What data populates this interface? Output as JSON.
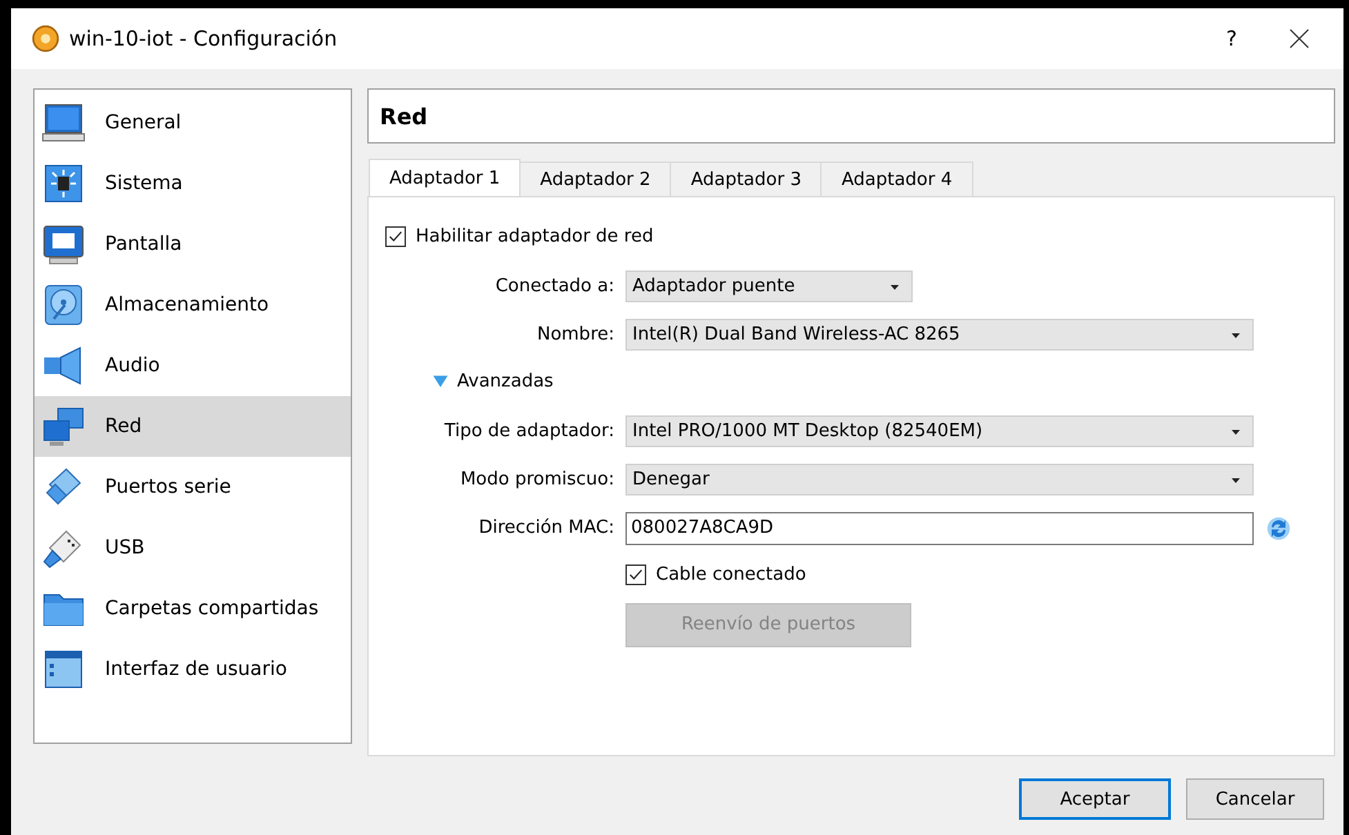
{
  "window": {
    "title": "win-10-iot - Configuración",
    "help": "?"
  },
  "sidebar": {
    "items": [
      {
        "label": "General",
        "selected": false
      },
      {
        "label": "Sistema",
        "selected": false
      },
      {
        "label": "Pantalla",
        "selected": false
      },
      {
        "label": "Almacenamiento",
        "selected": false
      },
      {
        "label": "Audio",
        "selected": false
      },
      {
        "label": "Red",
        "selected": true
      },
      {
        "label": "Puertos serie",
        "selected": false
      },
      {
        "label": "USB",
        "selected": false
      },
      {
        "label": "Carpetas compartidas",
        "selected": false
      },
      {
        "label": "Interfaz de usuario",
        "selected": false
      }
    ]
  },
  "page": {
    "title": "Red",
    "tabs": [
      {
        "label": "Adaptador 1",
        "selected": true
      },
      {
        "label": "Adaptador 2",
        "selected": false
      },
      {
        "label": "Adaptador 3",
        "selected": false
      },
      {
        "label": "Adaptador 4",
        "selected": false
      }
    ],
    "rows": [
      {
        "kind": "checkbox",
        "label": "Habilitar adaptador de red",
        "checked": true
      },
      {
        "kind": "combo",
        "label": "Conectado a:",
        "value": "Adaptador puente",
        "wide": false
      },
      {
        "kind": "combo",
        "label": "Nombre:",
        "value": "Intel(R) Dual Band Wireless-AC 8265",
        "wide": true
      },
      {
        "kind": "disclosure",
        "label": "Avanzadas",
        "expanded": true
      },
      {
        "kind": "combo",
        "label": "Tipo de adaptador:",
        "value": "Intel PRO/1000 MT Desktop (82540EM)",
        "wide": true
      },
      {
        "kind": "combo",
        "label": "Modo promiscuo:",
        "value": "Denegar",
        "wide": true
      },
      {
        "kind": "text",
        "label": "Dirección MAC:",
        "value": "080027A8CA9D"
      },
      {
        "kind": "subcheckbox",
        "label": "Cable conectado",
        "checked": true
      },
      {
        "kind": "button",
        "label": "Reenvío de puertos",
        "disabled": true
      }
    ]
  },
  "buttons": [
    {
      "label": "Aceptar",
      "default": true
    },
    {
      "label": "Cancelar",
      "default": false
    }
  ]
}
